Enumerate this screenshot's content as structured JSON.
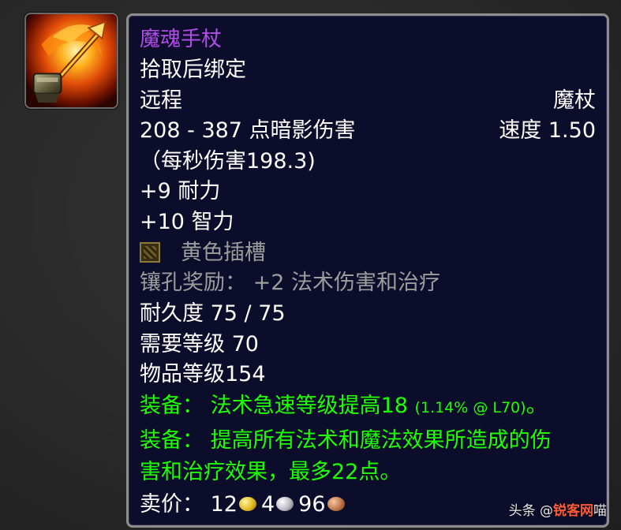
{
  "item": {
    "name": "魔魂手杖",
    "bind": "拾取后绑定",
    "slot": "远程",
    "type": "魔杖",
    "damage": "208 - 387 点暗影伤害",
    "speed": "速度 1.50",
    "dps": "（每秒伤害198.3)",
    "stats": [
      "+9 耐力",
      "+10 智力"
    ],
    "socket": "黄色插槽",
    "socket_bonus": "镶孔奖励： +2 法术伤害和治疗",
    "durability": "耐久度 75 / 75",
    "required_level": "需要等级 70",
    "item_level": "物品等级154",
    "equip1_prefix": "装备：  法术急速等级提高18 ",
    "equip1_detail": "(1.14% @ L70)",
    "equip1_suffix": "。",
    "equip2_line1": "装备：  提高所有法术和魔法效果所造成的伤",
    "equip2_line2": "害和治疗效果，最多22点。",
    "sell_label": "卖价：",
    "sell_gold": "12",
    "sell_silver": "4",
    "sell_copper": "96"
  },
  "icons": {
    "item_icon": "fire-wand-icon",
    "socket_icon": "yellow-socket-icon",
    "gold": "gold-coin-icon",
    "silver": "silver-coin-icon",
    "copper": "copper-coin-icon"
  },
  "colors": {
    "tooltip_bg": "#0c0d2b",
    "epic": "#b14de8",
    "equip_green": "#1eff00",
    "gray": "#9d9d9d"
  },
  "watermark": {
    "prefix": "头条 @",
    "brand": "锐客网",
    "suffix": "喵"
  }
}
